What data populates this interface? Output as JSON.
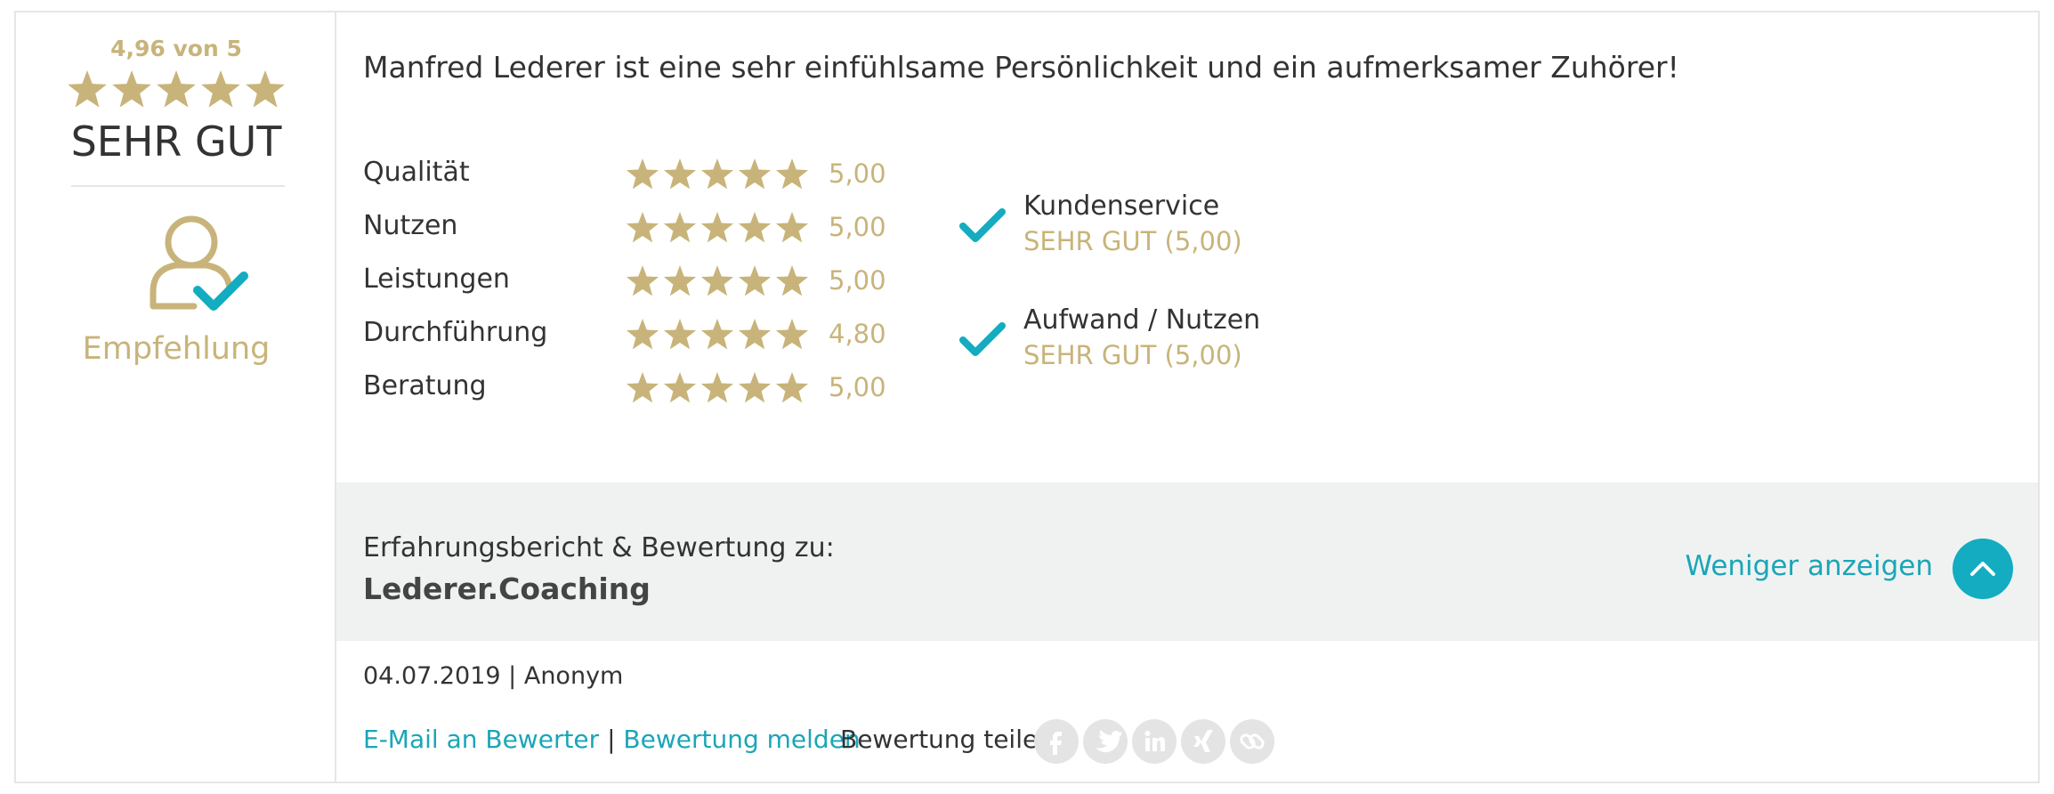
{
  "summary": {
    "score_text": "4,96 von 5",
    "score": 4.96,
    "verdict": "SEHR GUT",
    "recommendation_label": "Empfehlung",
    "recommendation_icon": "user-check-icon"
  },
  "review": {
    "headline": "Manfred Lederer ist eine sehr einfühlsame Persönlichkeit und ein aufmerksamer Zuhörer!",
    "ratings": [
      {
        "label": "Qualität",
        "value": "5,00",
        "stars": 5
      },
      {
        "label": "Nutzen",
        "value": "5,00",
        "stars": 5
      },
      {
        "label": "Leistungen",
        "value": "5,00",
        "stars": 5
      },
      {
        "label": "Durchführung",
        "value": "4,80",
        "stars": 5
      },
      {
        "label": "Beratung",
        "value": "5,00",
        "stars": 5
      }
    ],
    "features": [
      {
        "name": "Kundenservice",
        "value": "SEHR GUT (5,00)"
      },
      {
        "name": "Aufwand / Nutzen",
        "value": "SEHR GUT (5,00)"
      }
    ]
  },
  "band": {
    "title": "Erfahrungsbericht & Bewertung zu:",
    "company": "Lederer.Coaching",
    "toggle_label": "Weniger anzeigen",
    "toggle_icon": "chevron-up-icon"
  },
  "meta": {
    "line": "04.07.2019 | Anonym"
  },
  "actions": {
    "email_label": "E-Mail an Bewerter",
    "separator": "|",
    "report_label": "Bewertung melden",
    "share_label": "Bewertung teilen:",
    "share_icons": [
      "facebook-icon",
      "twitter-icon",
      "linkedin-icon",
      "xing-icon",
      "link-icon"
    ]
  },
  "colors": {
    "gold": "#c8b47a",
    "teal": "#1aa6b7",
    "band_bg": "#f0f2f2",
    "border": "#e6e6e6"
  }
}
